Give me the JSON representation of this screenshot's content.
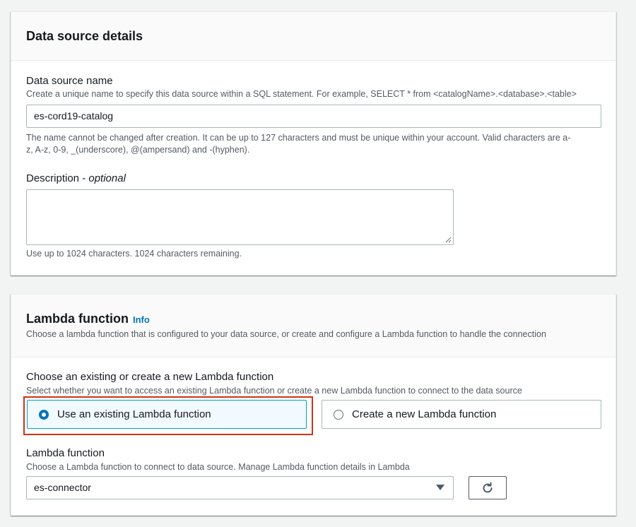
{
  "data_source_panel": {
    "title": "Data source details",
    "name_label": "Data source name",
    "name_description": "Create a unique name to specify this data source within a SQL statement. For example, SELECT * from <catalogName>.<database>.<table>",
    "name_value": "es-cord19-catalog",
    "name_constraint_line1": "The name cannot be changed after creation. It can be up to 127 characters and must be unique within your account. Valid characters are a-",
    "name_constraint_line2": "z, A-z, 0-9, _(underscore), @(ampersand) and -(hyphen).",
    "description_label": "Description - ",
    "description_optional": "optional",
    "description_value": "",
    "description_hint": "Use up to 1024 characters. 1024 characters remaining."
  },
  "lambda_panel": {
    "title": "Lambda function",
    "info": "Info",
    "subtitle": "Choose a lambda function that is configured to your data source, or create and configure a Lambda function to handle the connection",
    "choice_label": "Choose an existing or create a new Lambda function",
    "choice_description": "Select whether you want to access an existing Lambda function or create a new Lambda function to connect to the data source",
    "option_existing": "Use an existing Lambda function",
    "option_new": "Create a new Lambda function",
    "selected_option": "option_existing",
    "function_label": "Lambda function",
    "function_description": "Choose a Lambda function to connect to data source. Manage Lambda function details in Lambda",
    "function_value": "es-connector"
  },
  "colors": {
    "accent": "#0073bb",
    "highlight": "#d13212"
  }
}
